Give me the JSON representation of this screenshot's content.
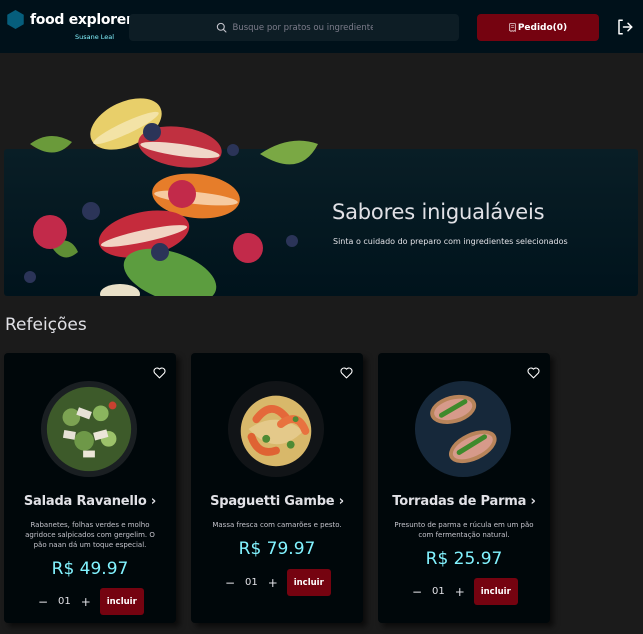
{
  "header": {
    "brand": "food explorer",
    "user": "Susane Leal",
    "search_placeholder": "Busque por pratos ou ingredientes",
    "order_label": "Pedido(0)"
  },
  "banner": {
    "title": "Sabores inigualáveis",
    "subtitle": "Sinta o cuidado do preparo com ingredientes selecionados"
  },
  "section": {
    "title": "Refeições"
  },
  "dishes": [
    {
      "name": "Salada Ravanello ›",
      "description": "Rabanetes, folhas verdes e molho agridoce salpicados com gergelim. O pão naan dá um toque especial.",
      "price": "R$ 49.97",
      "quantity": "01",
      "add_label": "incluir",
      "minus": "−",
      "plus": "+"
    },
    {
      "name": "Spaguetti Gambe ›",
      "description": "Massa fresca com camarões e pesto.",
      "price": "R$ 79.97",
      "quantity": "01",
      "add_label": "incluir",
      "minus": "−",
      "plus": "+"
    },
    {
      "name": "Torradas de Parma ›",
      "description": "Presunto de parma e rúcula em um pão com fermentação natural.",
      "price": "R$ 25.97",
      "quantity": "01",
      "add_label": "incluir",
      "minus": "−",
      "plus": "+"
    }
  ],
  "colors": {
    "header_bg": "#00111a",
    "accent_red": "#750310",
    "price_cyan": "#82f3ff",
    "logo_blue": "#065e7c"
  }
}
